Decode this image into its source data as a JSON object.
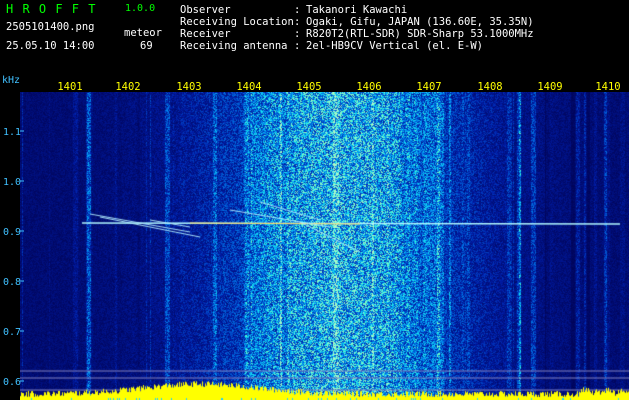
{
  "header": {
    "app_name": "H R O F F T",
    "version": "1.0.0",
    "filename": "2505101400.png",
    "datetime": "25.05.10 14:00",
    "meteor_label": "meteor",
    "meteor_count": "69",
    "info": [
      {
        "label": "Observer",
        "sep": ":",
        "value": "Takanori Kawachi"
      },
      {
        "label": "Receiving Location",
        "sep": ":",
        "value": "Ogaki, Gifu, JAPAN (136.60E, 35.35N)"
      },
      {
        "label": "Receiver",
        "sep": ":",
        "value": "R820T2(RTL-SDR) SDR-Sharp 53.1000MHz"
      },
      {
        "label": "Receiving antenna",
        "sep": ":",
        "value": "2el-HB9CV Vertical (el. E-W)"
      }
    ]
  },
  "axes": {
    "y_unit": "kHz",
    "y_ticks": [
      "1.1",
      "1.0",
      "0.9",
      "0.8",
      "0.7",
      "0.6"
    ],
    "x_ticks": [
      "1401",
      "1402",
      "1403",
      "1404",
      "1405",
      "1406",
      "1407",
      "1408",
      "1409",
      "1410"
    ]
  },
  "colors": {
    "title_green": "#00ff00",
    "info_yellow": "#ffff00",
    "tick_label_yellow": "#ffff00",
    "y_label_cyan": "#40c0ff",
    "spectrogram_base": "#00004e",
    "signal_yellow": "#ffff00"
  }
}
